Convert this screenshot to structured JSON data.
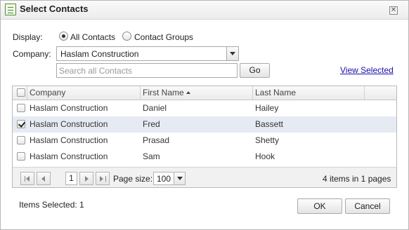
{
  "window": {
    "title": "Select Contacts",
    "icon": "contact-list-icon",
    "close_icon": "close-icon"
  },
  "filters": {
    "display_label": "Display:",
    "display_options": [
      {
        "label": "All Contacts",
        "selected": true
      },
      {
        "label": "Contact Groups",
        "selected": false
      }
    ],
    "company_label": "Company:",
    "company_value": "Haslam Construction",
    "search_placeholder": "Search all Contacts",
    "go_label": "Go",
    "view_selected_label": "View Selected"
  },
  "grid": {
    "columns": [
      "Company",
      "First Name",
      "Last Name"
    ],
    "sorted_column": "First Name",
    "sort_direction": "ascending",
    "rows": [
      {
        "company": "Haslam Construction",
        "first_name": "Daniel",
        "last_name": "Hailey",
        "checked": false
      },
      {
        "company": "Haslam Construction",
        "first_name": "Fred",
        "last_name": "Bassett",
        "checked": true
      },
      {
        "company": "Haslam Construction",
        "first_name": "Prasad",
        "last_name": "Shetty",
        "checked": false
      },
      {
        "company": "Haslam Construction",
        "first_name": "Sam",
        "last_name": "Hook",
        "checked": false
      }
    ],
    "pager": {
      "current_page": "1",
      "page_size_label": "Page size:",
      "page_size": "100",
      "summary": "4 items in 1 pages"
    }
  },
  "footer": {
    "items_selected": "Items Selected: 1",
    "ok_label": "OK",
    "cancel_label": "Cancel"
  },
  "colors": {
    "selected_row": "#e6ebf3",
    "link": "#1a0dab"
  }
}
